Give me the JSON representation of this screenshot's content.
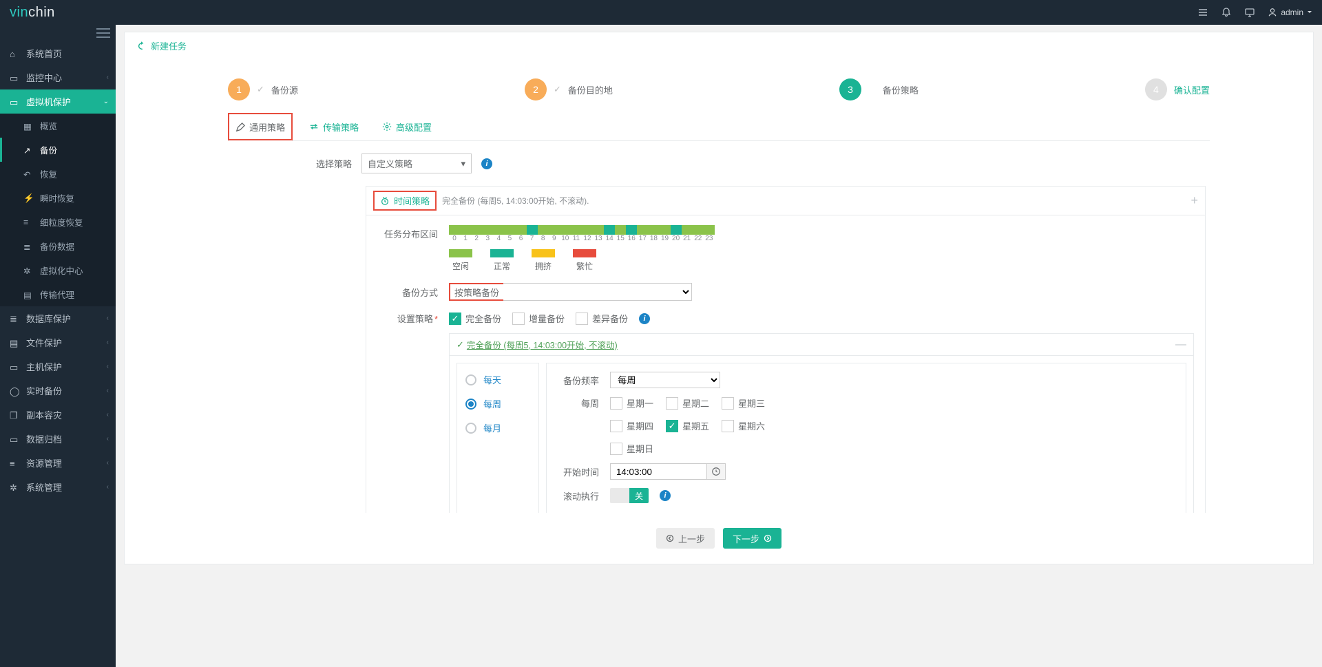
{
  "brand": {
    "vin": "vin",
    "chin": "chin"
  },
  "topbar": {
    "user": "admin"
  },
  "sidebar": {
    "home": "系统首页",
    "monitor": "监控中心",
    "vmprotect": "虚拟机保护",
    "vmprotect_children": {
      "overview": "概览",
      "backup": "备份",
      "restore": "恢复",
      "instant": "瞬时恢复",
      "granular": "细粒度恢复",
      "backupdata": "备份数据",
      "virtcenter": "虚拟化中心",
      "agent": "传输代理"
    },
    "dbprotect": "数据库保护",
    "fileprotect": "文件保护",
    "hostprotect": "主机保护",
    "realtime": "实时备份",
    "replica": "副本容灾",
    "archive": "数据归档",
    "resource": "资源管理",
    "system": "系统管理"
  },
  "panel": {
    "title": "新建任务"
  },
  "steps": {
    "s1": "备份源",
    "s2": "备份目的地",
    "s3": "备份策略",
    "s4": "确认配置"
  },
  "tabs": {
    "general": "通用策略",
    "transport": "传输策略",
    "advanced": "高级配置"
  },
  "form": {
    "select_strategy": "选择策略",
    "strategy_value": "自定义策略",
    "time_strategy_title": "时间策略",
    "time_strategy_summary": "完全备份 (每周5, 14:03:00开始, 不滚动).",
    "dist_label": "任务分布区间",
    "legend": {
      "idle": "空闲",
      "normal": "正常",
      "crowd": "拥挤",
      "busy": "繁忙"
    },
    "backup_method_label": "备份方式",
    "backup_method_value": "按策略备份",
    "set_strategy_label": "设置策略",
    "full_backup": "完全备份",
    "incr_backup": "增量备份",
    "diff_backup": "差异备份",
    "sched_link": " 完全备份 (每周5, 14:03:00开始, 不滚动)",
    "freq_daily": "每天",
    "freq_weekly": "每周",
    "freq_monthly": "每月",
    "backup_freq_label": "备份频率",
    "backup_freq_value": "每周",
    "weekly_label": "每周",
    "days": {
      "d1": "星期一",
      "d2": "星期二",
      "d3": "星期三",
      "d4": "星期四",
      "d5": "星期五",
      "d6": "星期六",
      "d7": "星期日"
    },
    "start_time_label": "开始时间",
    "start_time_value": "14:03:00",
    "roll_label": "滚动执行",
    "switch_off": "关"
  },
  "hours": {
    "colors": [
      "#8bc34a",
      "#8bc34a",
      "#8bc34a",
      "#8bc34a",
      "#8bc34a",
      "#8bc34a",
      "#8bc34a",
      "#1ab394",
      "#8bc34a",
      "#8bc34a",
      "#8bc34a",
      "#8bc34a",
      "#8bc34a",
      "#8bc34a",
      "#1ab394",
      "#8bc34a",
      "#1ab394",
      "#8bc34a",
      "#8bc34a",
      "#8bc34a",
      "#1ab394",
      "#8bc34a",
      "#8bc34a",
      "#8bc34a"
    ],
    "ticks": [
      "0",
      "1",
      "2",
      "3",
      "4",
      "5",
      "6",
      "7",
      "8",
      "9",
      "10",
      "11",
      "12",
      "13",
      "14",
      "15",
      "16",
      "17",
      "18",
      "19",
      "20",
      "21",
      "22",
      "23"
    ]
  },
  "buttons": {
    "prev": "上一步",
    "next": "下一步"
  }
}
